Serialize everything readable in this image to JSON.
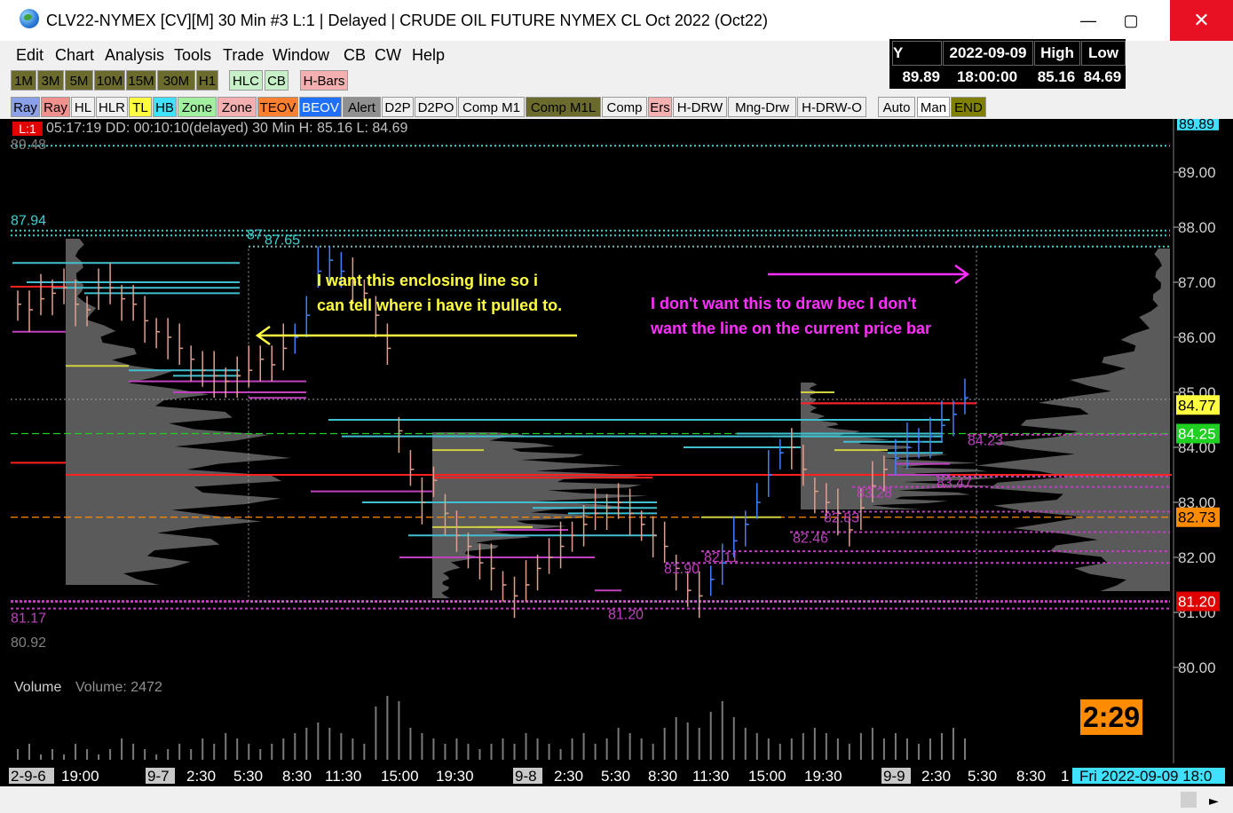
{
  "window": {
    "title": "CLV22-NYMEX [CV][M]  30 Min   #3 L:1 | Delayed | CRUDE OIL FUTURE NYMEX CL Oct 2022 (Oct22)",
    "min_glyph": "—",
    "max_glyph": "▢",
    "close_glyph": "✕"
  },
  "menu": [
    "Edit",
    "Chart",
    "Analysis",
    "Tools",
    "Trade",
    "Window",
    "CB",
    "CW",
    "Help"
  ],
  "toolbar1": [
    {
      "label": "1M",
      "bg": "#6b6b2e"
    },
    {
      "label": "3M",
      "bg": "#6b6b2e"
    },
    {
      "label": "5M",
      "bg": "#6b6b2e"
    },
    {
      "label": "10M",
      "bg": "#6b6b2e"
    },
    {
      "label": "15M",
      "bg": "#6b6b2e"
    },
    {
      "label": "30M",
      "bg": "#6b6b2e"
    },
    {
      "label": "H1",
      "bg": "#6b6b2e"
    },
    {
      "label": "HLC",
      "bg": "#c8f0c8"
    },
    {
      "label": "CB",
      "bg": "#c8f0c8"
    },
    {
      "label": "H-Bars",
      "bg": "#f4b0b0"
    }
  ],
  "toolbar2": [
    {
      "label": "Ray",
      "bg": "#8aa0e8"
    },
    {
      "label": "Ray",
      "bg": "#f29090"
    },
    {
      "label": "HL",
      "bg": "#f0f0f0"
    },
    {
      "label": "HLR",
      "bg": "#f0f0f0"
    },
    {
      "label": "TL",
      "bg": "#ffff40"
    },
    {
      "label": "HB",
      "bg": "#40e0ff"
    },
    {
      "label": "Zone",
      "bg": "#a0f0a0"
    },
    {
      "label": "Zone",
      "bg": "#f4b0b0"
    },
    {
      "label": "TEOV",
      "bg": "#ff8030"
    },
    {
      "label": "BEOV",
      "bg": "#2070ff"
    },
    {
      "label": "Alert",
      "bg": "#909090"
    },
    {
      "label": "D2P",
      "bg": "#f0f0f0"
    },
    {
      "label": "D2PO",
      "bg": "#f0f0f0"
    },
    {
      "label": "Comp M1",
      "bg": "#f0f0f0"
    },
    {
      "label": "Comp M1L",
      "bg": "#6b6b2e"
    },
    {
      "label": "Comp",
      "bg": "#f0f0f0"
    },
    {
      "label": "Ers",
      "bg": "#f4b0b0"
    },
    {
      "label": "H-DRW",
      "bg": "#f0f0f0"
    },
    {
      "label": "Mng-Drw",
      "bg": "#f0f0f0"
    },
    {
      "label": "H-DRW-O",
      "bg": "#f0f0f0"
    },
    {
      "label": "Auto",
      "bg": "#f0f0f0"
    },
    {
      "label": "Man",
      "bg": "#ffffff"
    },
    {
      "label": "END",
      "bg": "#808000"
    }
  ],
  "infobox": {
    "y_label": "Y",
    "date": "2022-09-09",
    "high_label": "High",
    "low_label": "Low",
    "close": "89.89",
    "time": "18:00:00",
    "high": "85.16",
    "low": "84.69"
  },
  "status_line": {
    "tag": "L:1",
    "text": "05:17:19 DD: 00:10:10(delayed) 30 Min  H: 85.16 L: 84.69"
  },
  "price_axis": {
    "ticks": [
      "89.00",
      "88.00",
      "87.00",
      "86.00",
      "85.00",
      "84.00",
      "83.00",
      "82.00",
      "81.00",
      "80.00"
    ],
    "top_label": "89.89",
    "labels": [
      {
        "text": "84.77",
        "bg": "#ffff40",
        "fg": "#000"
      },
      {
        "text": "84.25",
        "bg": "#20d020",
        "fg": "#fff"
      },
      {
        "text": "82.73",
        "bg": "#ff8c00",
        "fg": "#000"
      },
      {
        "text": "81.20",
        "bg": "#e00000",
        "fg": "#fff"
      }
    ]
  },
  "level_labels": [
    "89.48",
    "87.94",
    "87",
    "87.65",
    "84.23",
    "83.47",
    "83.28",
    "82.83",
    "82.46",
    "82.11",
    "81.90",
    "81.20",
    "81.17",
    "80.92"
  ],
  "annotations": {
    "yellow_line1": "I want this enclosing line so i",
    "yellow_line2": "can tell where i have it pulled to.",
    "magenta_line1": "I don't want this to draw bec I don't",
    "magenta_line2": "want the line on the current price bar"
  },
  "volume": {
    "label": "Volume",
    "value_label": "Volume: 2472"
  },
  "timer": "2:29",
  "time_axis": {
    "labels": [
      "2-9-6",
      "19:00",
      "9-7",
      "2:30",
      "5:30",
      "8:30",
      "11:30",
      "15:00",
      "19:30",
      "9-8",
      "2:30",
      "5:30",
      "8:30",
      "11:30",
      "15:00",
      "19:30",
      "9-9",
      "2:30",
      "5:30",
      "8:30",
      "1"
    ],
    "current": "Fri 2022-09-09  18:0"
  },
  "colors": {
    "bg": "#000000",
    "cyan": "#40d0d0",
    "magenta": "#c040c0",
    "yellow": "#ffff40",
    "red": "#ff2020",
    "profile": "#5a5a5a"
  }
}
